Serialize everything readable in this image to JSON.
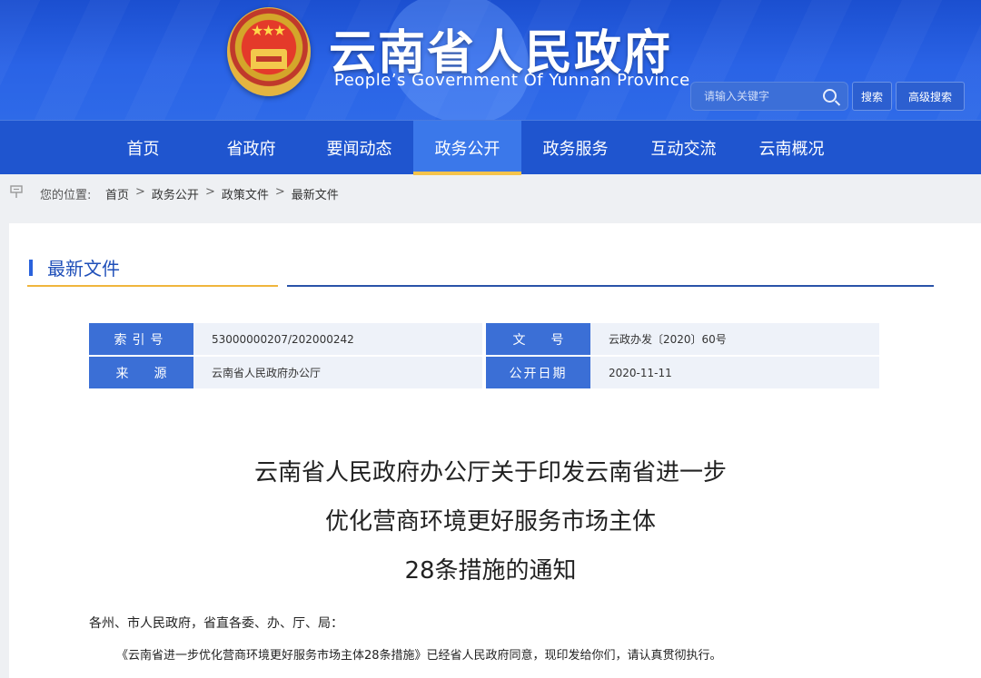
{
  "header": {
    "title": "云南省人民政府",
    "subtitle": "People’s Government Of Yunnan Province",
    "search_placeholder": "请输入关键字",
    "search_button": "搜索",
    "advanced_button": "高级搜索"
  },
  "nav": {
    "items": [
      "首页",
      "省政府",
      "要闻动态",
      "政务公开",
      "政务服务",
      "互动交流",
      "云南概况"
    ],
    "active_index": 3
  },
  "breadcrumb": {
    "label": "您的位置:",
    "items": [
      "首页",
      "政务公开",
      "政策文件",
      "最新文件"
    ],
    "separator": ">"
  },
  "section": {
    "title": "最新文件"
  },
  "meta": {
    "index_label": "索引号",
    "index_value": "53000000207/202000242",
    "doc_no_label": "文号",
    "doc_no_value": "云政办发〔2020〕60号",
    "source_label": "来源",
    "source_value": "云南省人民政府办公厅",
    "date_label": "公开日期",
    "date_value": "2020-11-11"
  },
  "document": {
    "title_lines": [
      "云南省人民政府办公厅关于印发云南省进一步",
      "优化营商环境更好服务市场主体",
      "28条措施的通知"
    ],
    "salutation": "各州、市人民政府，省直各委、办、厅、局：",
    "paragraph": "《云南省进一步优化营商环境更好服务市场主体28条措施》已经省人民政府同意，现印发给你们，请认真贯彻执行。"
  },
  "colors": {
    "header_blue": "#1f55cf",
    "accent_gold": "#f5c34a",
    "label_blue": "#3b6fd6"
  }
}
